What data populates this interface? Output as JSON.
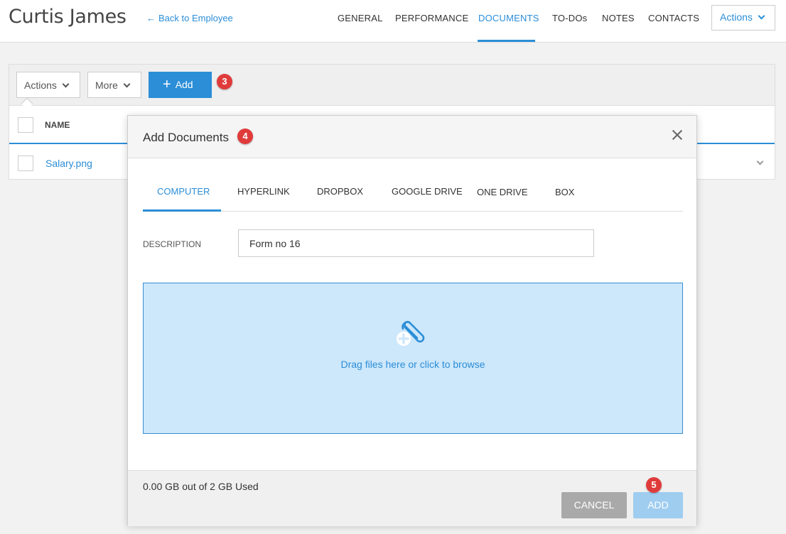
{
  "header": {
    "employee_name": "Curtis James",
    "back_arrow": "←",
    "back_label": "Back to Employee",
    "nav": [
      "GENERAL",
      "PERFORMANCE",
      "DOCUMENTS",
      "TO-DOs",
      "NOTES",
      "CONTACTS"
    ],
    "active_nav": "DOCUMENTS",
    "actions_label": "Actions"
  },
  "toolbar": {
    "actions_label": "Actions",
    "more_label": "More",
    "add_plus": "+",
    "add_label": "Add",
    "badge": "3"
  },
  "table": {
    "column_name": "NAME",
    "rows": [
      {
        "name": "Salary.png"
      }
    ]
  },
  "modal": {
    "title": "Add Documents",
    "title_badge": "4",
    "tabs": [
      "COMPUTER",
      "HYPERLINK",
      "DROPBOX",
      "GOOGLE DRIVE",
      "ONE DRIVE",
      "BOX"
    ],
    "active_tab": "COMPUTER",
    "description_label": "DESCRIPTION",
    "description_value": "Form no 16",
    "dropzone_text": "Drag files here or click to browse",
    "dropzone_icon": "paperclip-add-icon",
    "usage_text": "0.00 GB out of 2 GB Used",
    "cancel_label": "CANCEL",
    "add_label": "ADD",
    "add_badge": "5"
  },
  "colors": {
    "accent": "#2b8ed7",
    "badge": "#e03b3b",
    "dropzone_bg": "#cde7fb",
    "add_disabled": "#9fcdf0",
    "cancel": "#a9a9a9"
  }
}
